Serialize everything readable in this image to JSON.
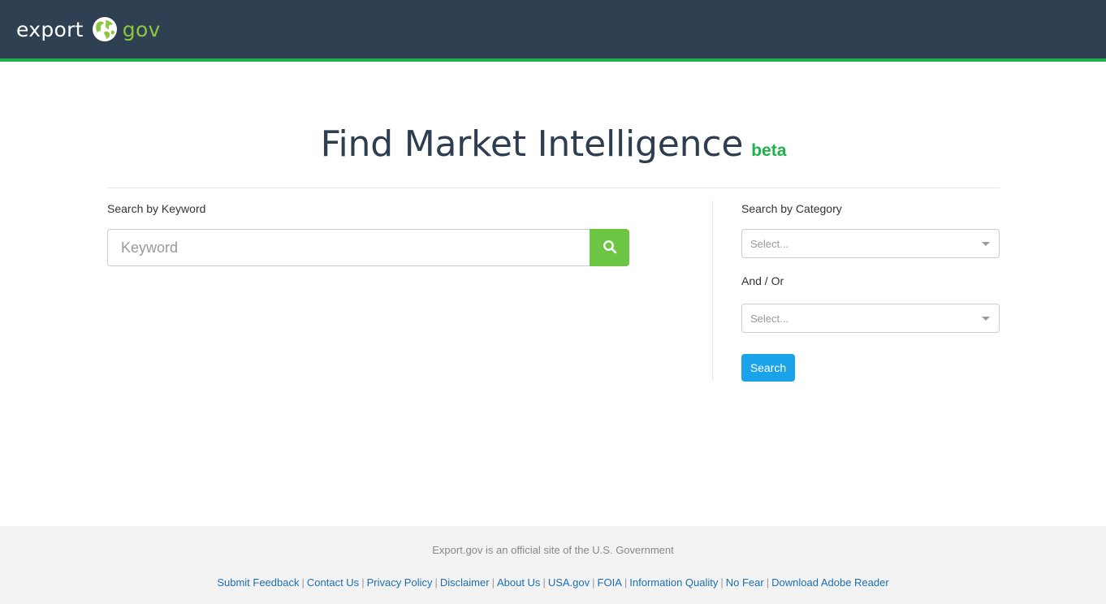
{
  "header": {
    "logo_export": "export",
    "logo_gov": "gov",
    "colors": {
      "bar": "#2f4052",
      "accent": "#1fb24a",
      "gov_green": "#8dc63f"
    }
  },
  "page": {
    "title": "Find Market Intelligence",
    "badge": "beta"
  },
  "keyword_search": {
    "label": "Search by Keyword",
    "placeholder": "Keyword",
    "value": "",
    "button_icon": "search-icon",
    "button_color": "#6cc644"
  },
  "category_search": {
    "label": "Search by Category",
    "select_1": {
      "value": "Select..."
    },
    "andor_label": "And / Or",
    "select_2": {
      "value": "Select..."
    },
    "button_label": "Search",
    "button_color": "#1aa3e8"
  },
  "footer": {
    "official": "Export.gov is an official site of the U.S. Government",
    "links": [
      "Submit Feedback",
      "Contact Us",
      "Privacy Policy",
      "Disclaimer",
      "About Us",
      "USA.gov",
      "FOIA",
      "Information Quality",
      "No Fear",
      "Download Adobe Reader"
    ],
    "separator": "|"
  }
}
